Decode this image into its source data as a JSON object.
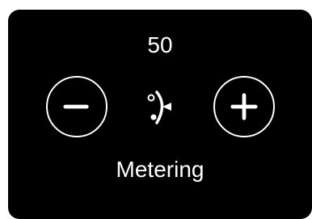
{
  "metering": {
    "value": "50",
    "label": "Metering",
    "decrease_icon": "minus-icon",
    "increase_icon": "plus-icon",
    "mode_icon": "metering-mode-icon"
  },
  "colors": {
    "panel_background": "#000000",
    "foreground": "#ffffff",
    "page_background": "#ffffff"
  }
}
